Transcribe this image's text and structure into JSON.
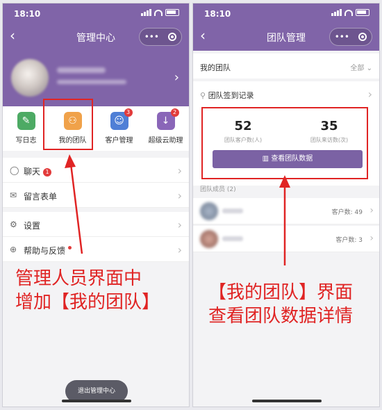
{
  "status": {
    "time": "18:10"
  },
  "left": {
    "nav_title": "管理中心",
    "nav_more": "•••",
    "shortcuts": [
      {
        "label": "写日志",
        "color": "#4daa64",
        "icon": "✎",
        "badge": ""
      },
      {
        "label": "我的团队",
        "color": "#f0a24a",
        "icon": "⚇",
        "badge": ""
      },
      {
        "label": "客户管理",
        "color": "#4f7fd6",
        "icon": "☺",
        "badge": "3"
      },
      {
        "label": "超级云助理",
        "color": "#8a66b8",
        "icon": "↓",
        "badge": "2"
      }
    ],
    "menu": [
      {
        "label": "聊天",
        "icon": "◯",
        "badge": "1"
      },
      {
        "label": "留言表单",
        "icon": "✉"
      },
      {
        "label": "设置",
        "icon": "⚙"
      },
      {
        "label": "帮助与反馈",
        "icon": "⊕"
      }
    ],
    "exit_button": "退出管理中心",
    "caption_lines": [
      "管理人员界面中",
      "增加【我的团队】"
    ]
  },
  "right": {
    "nav_title": "团队管理",
    "nav_more": "•••",
    "my_team_label": "我的团队",
    "filter_label": "全部",
    "checkin_label": "团队签到记录",
    "stats": [
      {
        "value": "52",
        "caption": "团队客户数(人)"
      },
      {
        "value": "35",
        "caption": "团队来访数(次)"
      }
    ],
    "view_button": "查看团队数据",
    "members_title": "团队成员 (2)",
    "members": [
      {
        "count": "客户数: 49"
      },
      {
        "count": "客户数: 3"
      }
    ],
    "caption_lines": [
      "【我的团队】界面",
      "查看团队数据详情"
    ]
  },
  "colors": {
    "accent": "#8064a8",
    "annotation": "#e02424"
  }
}
